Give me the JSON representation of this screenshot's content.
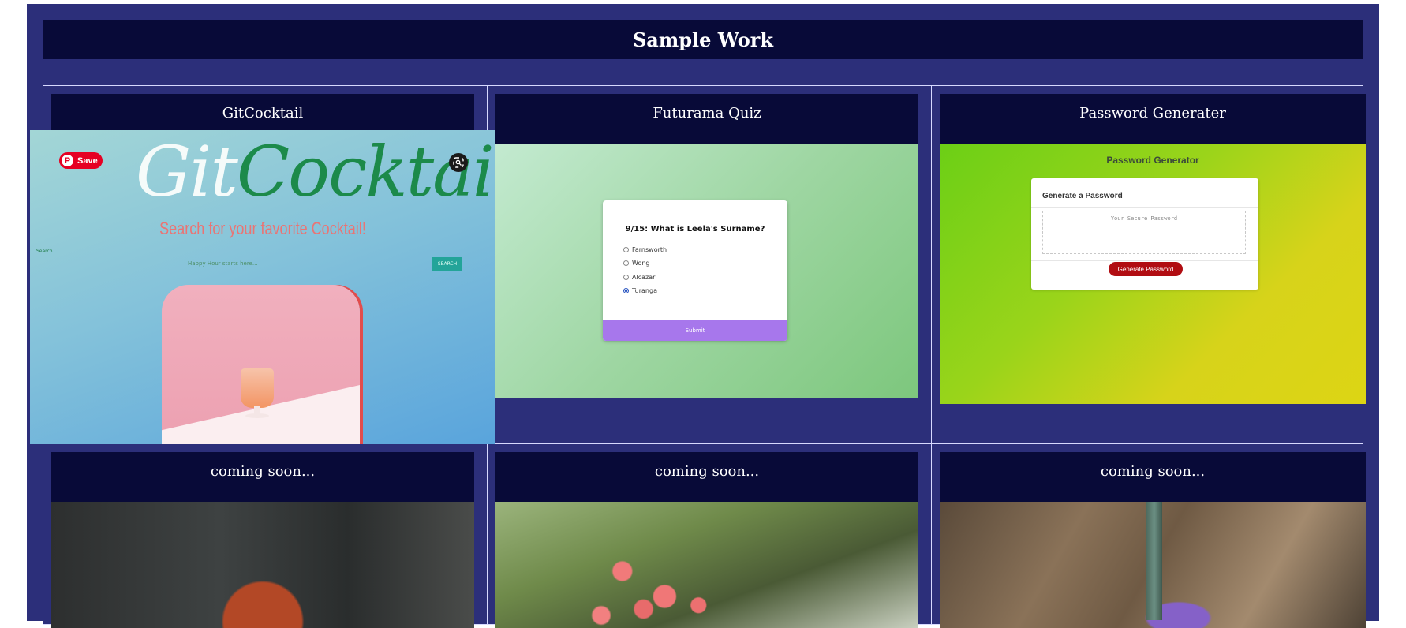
{
  "page": {
    "title": "Sample Work"
  },
  "projects": [
    {
      "title": "GitCocktail"
    },
    {
      "title": "Futurama Quiz"
    },
    {
      "title": "Password Generater"
    }
  ],
  "upcoming": [
    {
      "title": "coming soon..."
    },
    {
      "title": "coming soon..."
    },
    {
      "title": "coming soon..."
    }
  ],
  "gitcocktail": {
    "logo_left": "Git",
    "logo_right": "Cocktail",
    "tagline": "Search for your favorite Cocktail!",
    "small_label": "Search",
    "input_placeholder": "Happy Hour starts here...",
    "search_button": "SEARCH"
  },
  "pinterest": {
    "save_label": "Save",
    "icon": "pinterest-icon"
  },
  "lens": {
    "icon": "visual-search-icon"
  },
  "quiz": {
    "question": "9/15: What is Leela's Surname?",
    "options": [
      "Farnsworth",
      "Wong",
      "Alcazar",
      "Turanga"
    ],
    "selected": "Turanga",
    "submit": "Submit"
  },
  "password": {
    "heading": "Password Generator",
    "card_title": "Generate a Password",
    "placeholder": "Your Secure Password",
    "button": "Generate Password"
  },
  "colors": {
    "panel": "#2c2f7a",
    "header": "#080a38",
    "quiz_submit": "#a777ec",
    "pw_button": "#b10d12",
    "pinterest": "#e60023"
  }
}
